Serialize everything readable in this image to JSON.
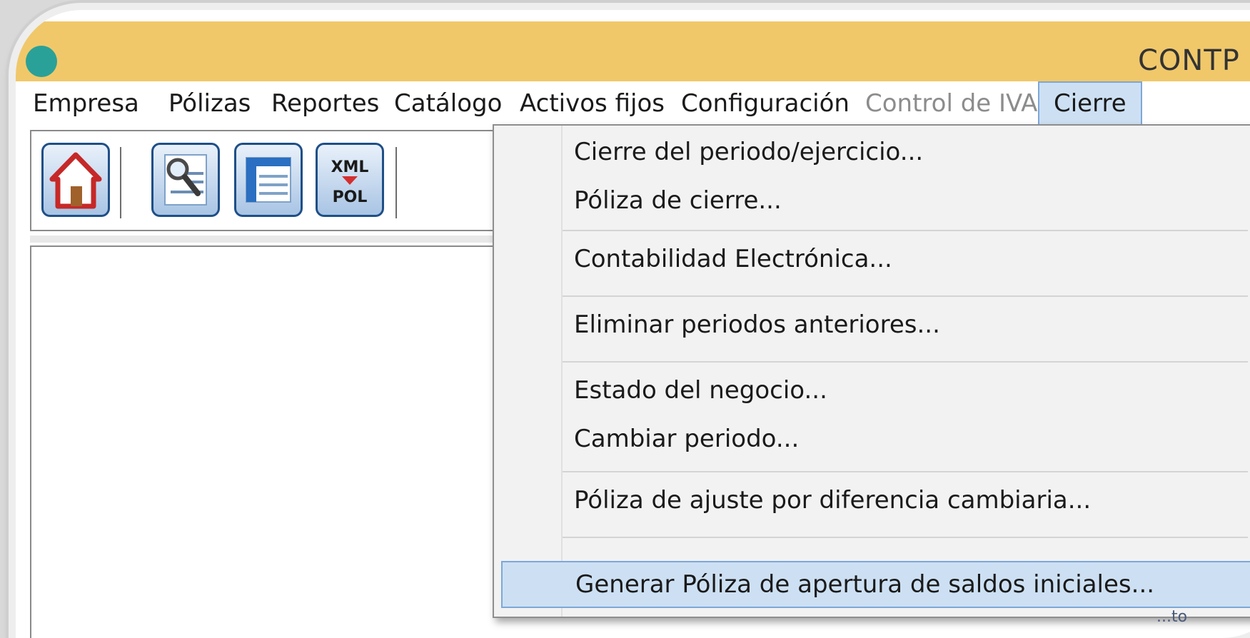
{
  "window": {
    "title": "CONTP"
  },
  "menubar": {
    "items": [
      {
        "label": "Empresa"
      },
      {
        "label": "Pólizas"
      },
      {
        "label": "Reportes"
      },
      {
        "label": "Catálogo"
      },
      {
        "label": "Activos fijos"
      },
      {
        "label": "Configuración"
      },
      {
        "label": "Control de IVA",
        "disabled": true
      },
      {
        "label": "Cierre",
        "active": true
      }
    ]
  },
  "toolbar": {
    "buttons": [
      {
        "icon": "home-icon"
      },
      {
        "icon": "search-document-icon"
      },
      {
        "icon": "window-list-icon"
      },
      {
        "icon": "xml-pol-icon",
        "text_top": "XML",
        "text_bottom": "POL"
      }
    ]
  },
  "dropdown": {
    "items": [
      {
        "label": "Cierre del periodo/ejercicio..."
      },
      {
        "label": "Póliza de cierre..."
      },
      {
        "label": "Contabilidad Electrónica..."
      },
      {
        "label": "Eliminar periodos anteriores..."
      },
      {
        "label": "Estado del negocio..."
      },
      {
        "label": "Cambiar periodo..."
      },
      {
        "label": "Póliza de ajuste por diferencia cambiaria..."
      },
      {
        "label": "Generar Póliza de apertura de saldos iniciales...",
        "highlighted": true
      }
    ]
  },
  "peek": {
    "text": "...to"
  },
  "colors": {
    "titlebar": "#f0c86a",
    "menu_highlight": "#cde0f3",
    "menu_highlight_border": "#7da7d9",
    "disabled_text": "#8c8c8c"
  }
}
